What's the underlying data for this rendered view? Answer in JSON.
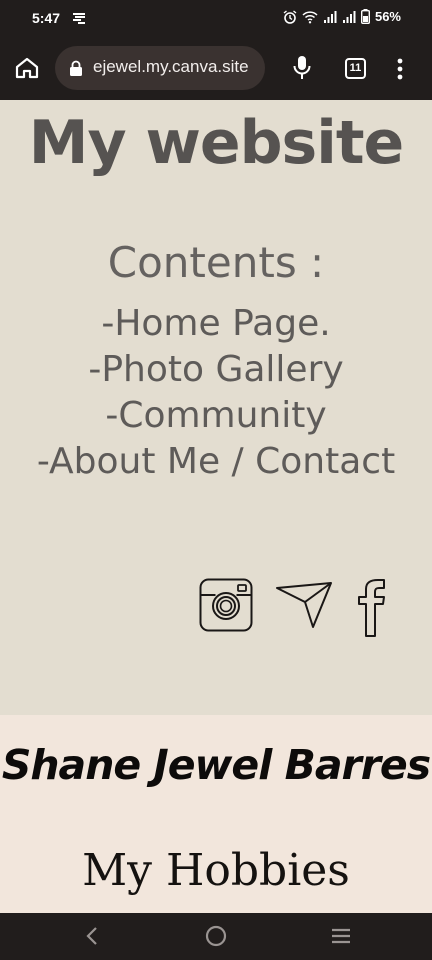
{
  "status_bar": {
    "time": "5:47",
    "battery": "56%",
    "icons": [
      "data-saver-icon",
      "alarm-icon",
      "wifi-icon",
      "signal-icon",
      "signal-icon",
      "battery-icon"
    ]
  },
  "browser": {
    "url": "ejewel.my.canva.site",
    "tab_count": "11",
    "icons": [
      "home-icon",
      "lock-icon",
      "mic-icon",
      "tabs-icon",
      "more-vert-icon"
    ]
  },
  "page": {
    "title": "My website",
    "contents_heading": "Contents :",
    "contents_items": [
      "-Home Page.",
      "-Photo Gallery",
      "-Community",
      "-About Me / Contact"
    ],
    "social_icons": [
      "instagram-icon",
      "send-icon",
      "facebook-icon"
    ],
    "owner_name": "Shane Jewel Barres",
    "hobbies_heading": "My Hobbies"
  },
  "nav_bar": {
    "icons": [
      "back-icon",
      "home-circle-icon",
      "recents-icon"
    ]
  },
  "colors": {
    "system_bar": "#211d1c",
    "page_background": "#e3ddd0",
    "name_band": "#f2e6dc",
    "title_text": "#565351"
  }
}
